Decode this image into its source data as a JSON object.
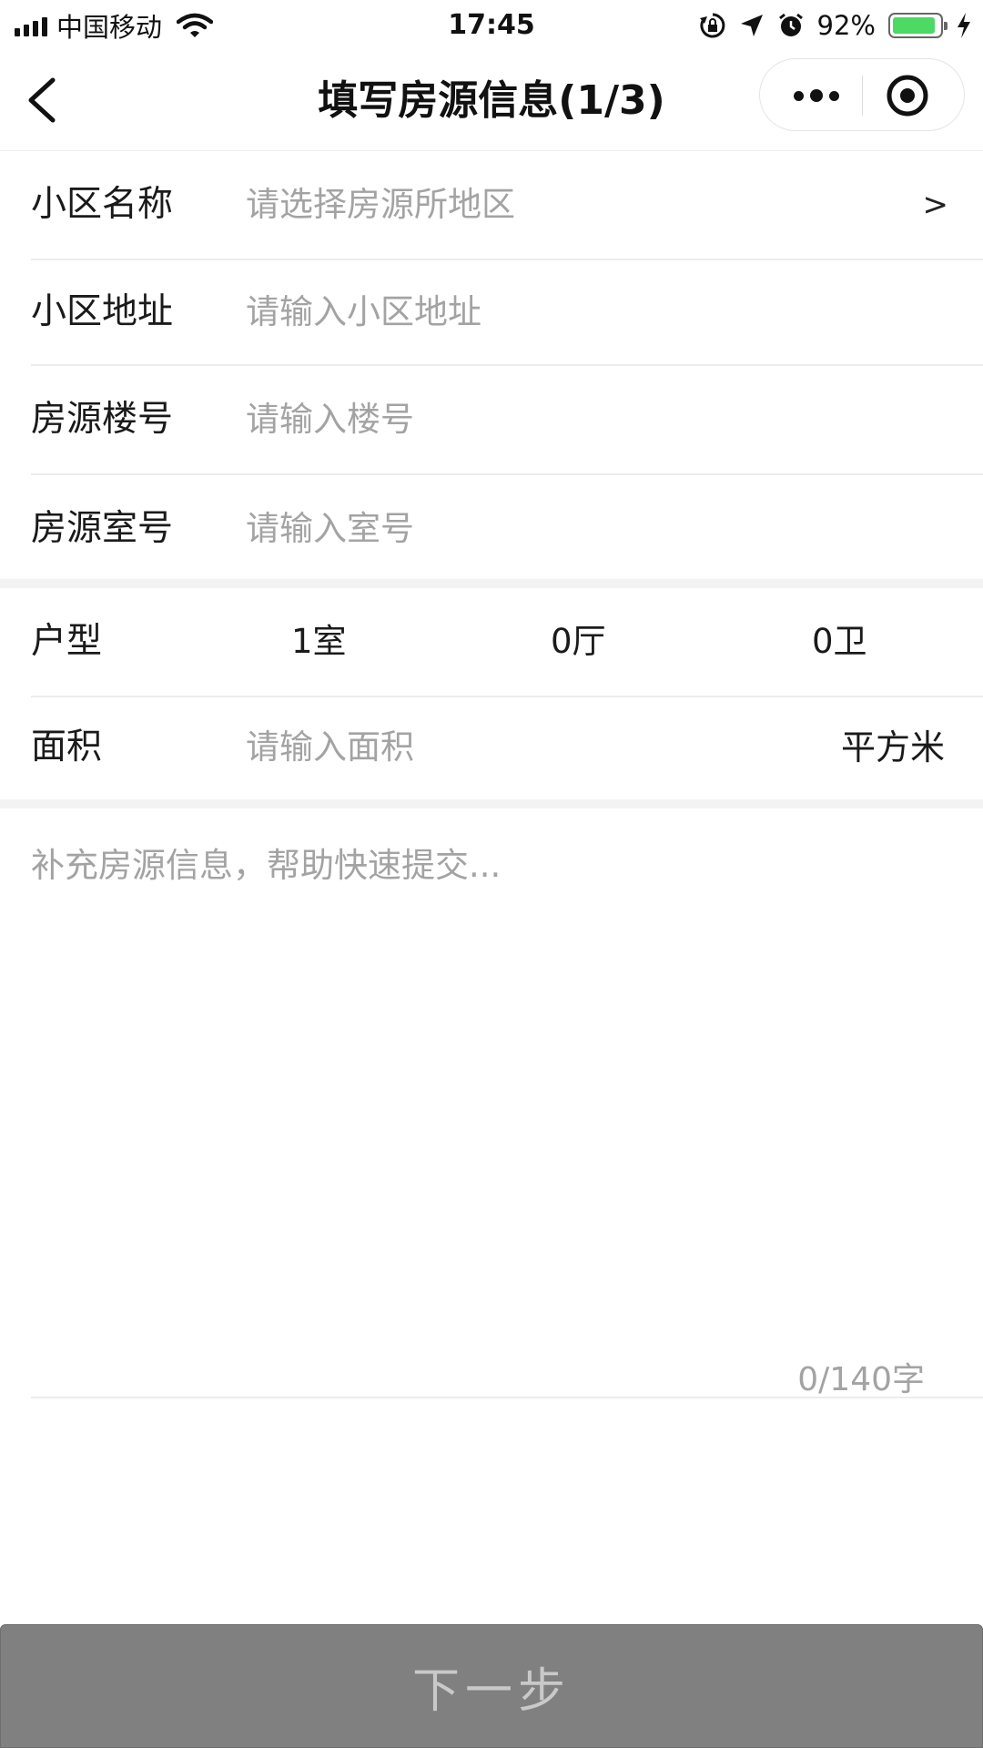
{
  "status_bar": {
    "carrier": "中国移动",
    "time": "17:45",
    "battery_percent": "92%",
    "battery_level": 0.92
  },
  "nav": {
    "title": "填写房源信息(1/3)",
    "back_icon": "chevron-left-icon",
    "more_icon": "more-dots-icon",
    "close_icon": "target-circle-icon"
  },
  "form": {
    "community_name": {
      "label": "小区名称",
      "placeholder": "请选择房源所地区",
      "arrow": ">"
    },
    "community_address": {
      "label": "小区地址",
      "placeholder": "请输入小区地址"
    },
    "building_no": {
      "label": "房源楼号",
      "placeholder": "请输入楼号"
    },
    "room_no": {
      "label": "房源室号",
      "placeholder": "请输入室号"
    },
    "layout": {
      "label": "户型",
      "bedrooms": "1室",
      "livingrooms": "0厅",
      "bathrooms": "0卫"
    },
    "area": {
      "label": "面积",
      "placeholder": "请输入面积",
      "unit": "平方米"
    }
  },
  "remark": {
    "placeholder": "补充房源信息，帮助快速提交...",
    "counter": "0/140字"
  },
  "footer": {
    "next_label": "下一步"
  },
  "colors": {
    "placeholder": "#a3a3a3",
    "divider": "#ececec",
    "section_gap": "#f3f3f3",
    "button_bg": "#808080",
    "button_text": "#c9c9c9",
    "battery_fill": "#4cd964"
  }
}
